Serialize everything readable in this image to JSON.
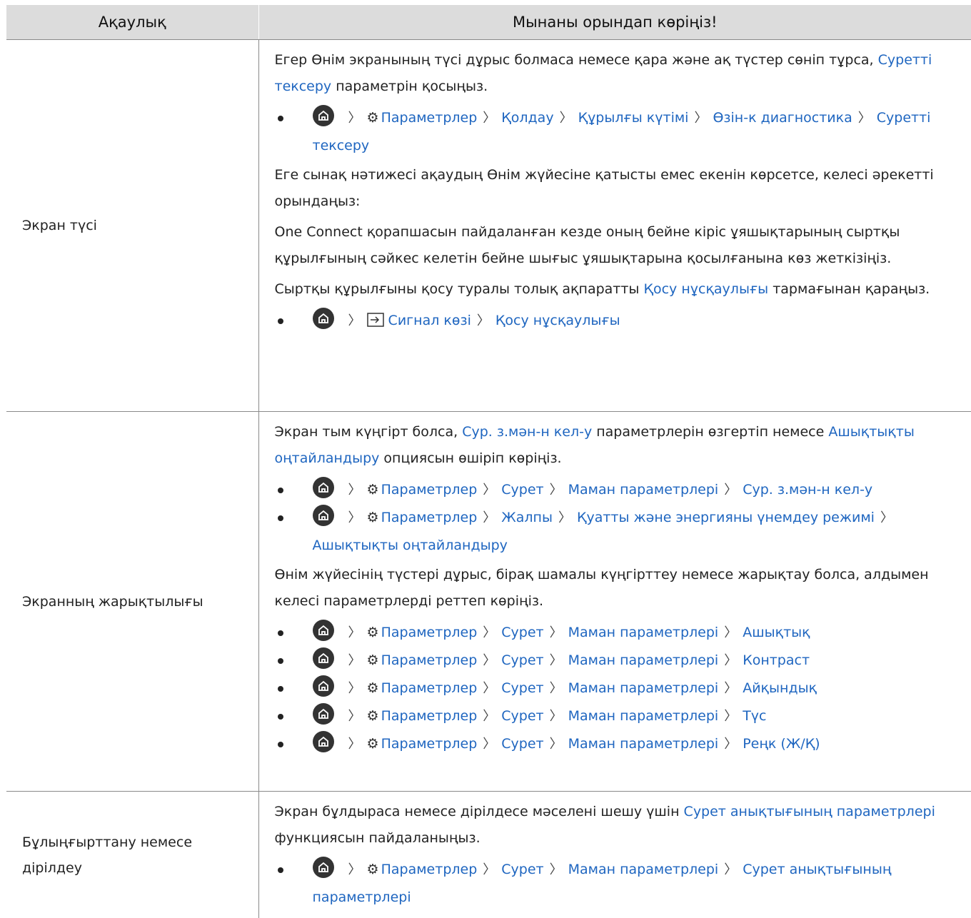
{
  "header": {
    "col_issue": "Ақаулық",
    "col_solution": "Мынаны орындап көріңіз!"
  },
  "rows": [
    {
      "issue": "Экран түсі",
      "p1_a": "Егер Өнім экранының түсі дұрыс болмаса немесе қара және ақ түстер сөніп тұрса, ",
      "p1_link": "Суретті тексеру",
      "p1_b": " параметрін қосыңыз.",
      "b1": [
        "Параметрлер",
        "Қолдау",
        "Құрылғы күтімі",
        "Өзін-к диагностика",
        "Суретті тексеру"
      ],
      "p2": "Еге сынақ нәтижесі ақаудың Өнім жүйесіне қатысты емес екенін көрсетсе, келесі әрекетті орындаңыз:",
      "p3": "One Connect қорапшасын пайдаланған кезде оның бейне кіріс ұяшықтарының сыртқы құрылғының сәйкес келетін бейне шығыс ұяшықтарына қосылғанына көз жеткізіңіз.",
      "p4_a": "Сыртқы құрылғыны қосу туралы толық ақпаратты ",
      "p4_link": "Қосу нұсқаулығы",
      "p4_b": " тармағынан қараңыз.",
      "b2": [
        "Сигнал көзі",
        "Қосу нұсқаулығы"
      ]
    },
    {
      "issue": "Экранның жарықтылығы",
      "p1_a": "Экран тым күңгірт болса, ",
      "p1_link1": "Сур. з.мән-н кел-у",
      "p1_b": " параметрлерін өзгертіп немесе ",
      "p1_link2": "Ашықтықты оңтайландыру",
      "p1_c": " опциясын өшіріп көріңіз.",
      "b1": [
        "Параметрлер",
        "Сурет",
        "Маман параметрлері",
        "Сур. з.мән-н кел-у"
      ],
      "b2": [
        "Параметрлер",
        "Жалпы",
        "Қуатты және энергияны үнемдеу режимі",
        "Ашықтықты оңтайландыру"
      ],
      "p2": "Өнім жүйесінің түстері дұрыс, бірақ шамалы күңгірттеу немесе жарықтау болса, алдымен келесі параметрлерді реттеп көріңіз.",
      "b3": [
        "Параметрлер",
        "Сурет",
        "Маман параметрлері",
        "Ашықтық"
      ],
      "b4": [
        "Параметрлер",
        "Сурет",
        "Маман параметрлері",
        "Контраст"
      ],
      "b5": [
        "Параметрлер",
        "Сурет",
        "Маман параметрлері",
        "Айқындық"
      ],
      "b6": [
        "Параметрлер",
        "Сурет",
        "Маман параметрлері",
        "Түс"
      ],
      "b7": [
        "Параметрлер",
        "Сурет",
        "Маман параметрлері",
        "Реңк (Ж/Қ)"
      ]
    },
    {
      "issue": "Бұлыңғырттану немесе дірілдеу",
      "p1_a": "Экран бұлдыраса немесе дірілдесе мәселені шешу үшін ",
      "p1_link": "Сурет анықтығының параметрлері",
      "p1_b": " функциясын пайдаланыңыз.",
      "b1": [
        "Параметрлер",
        "Сурет",
        "Маман параметрлері",
        "Сурет анықтығының параметрлері"
      ]
    }
  ],
  "icons": {
    "home": "home-icon",
    "settings": "gear-icon",
    "source": "source-input-icon",
    "separator": "chevron-right-icon"
  }
}
